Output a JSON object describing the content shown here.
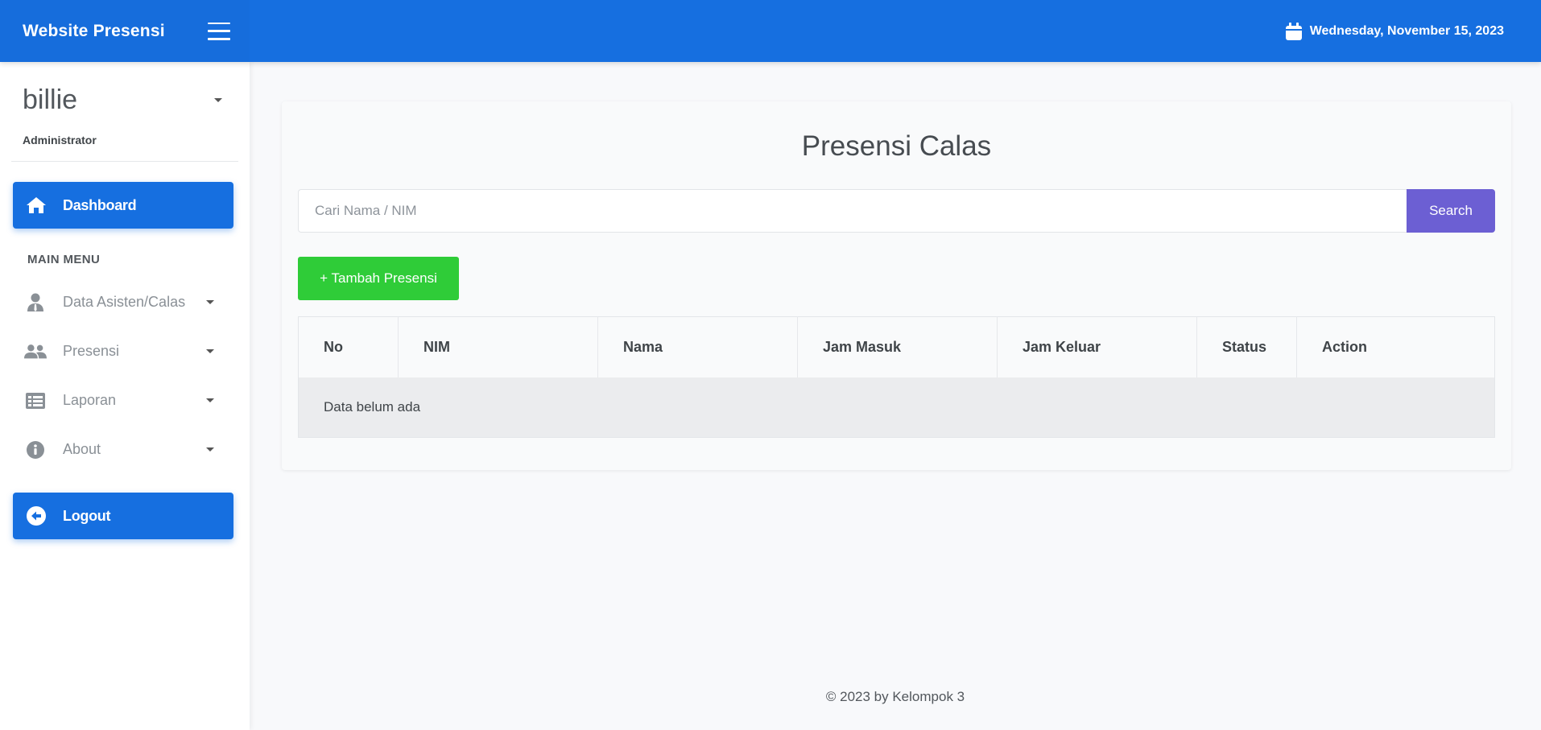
{
  "header": {
    "brand": "Website Presensi",
    "date": "Wednesday, November 15, 2023"
  },
  "user": {
    "name": "billie",
    "role": "Administrator"
  },
  "sidebar": {
    "dashboard_label": "Dashboard",
    "main_menu_heading": "MAIN MENU",
    "items": [
      {
        "label": "Data Asisten/Calas",
        "icon": "user-tie-icon"
      },
      {
        "label": "Presensi",
        "icon": "users-icon"
      },
      {
        "label": "Laporan",
        "icon": "list-icon"
      },
      {
        "label": "About",
        "icon": "info-icon"
      }
    ],
    "logout_label": "Logout"
  },
  "main": {
    "title": "Presensi Calas",
    "search": {
      "placeholder": "Cari Nama / NIM",
      "value": "",
      "button": "Search"
    },
    "add_button": "+ Tambah Presensi",
    "table": {
      "columns": [
        "No",
        "NIM",
        "Nama",
        "Jam Masuk",
        "Jam Keluar",
        "Status",
        "Action"
      ],
      "empty_message": "Data belum ada"
    }
  },
  "footer": "© 2023 by Kelompok 3",
  "colors": {
    "primary": "#166fe0",
    "search_button": "#6c5fd3",
    "add_button": "#2fcc38"
  }
}
